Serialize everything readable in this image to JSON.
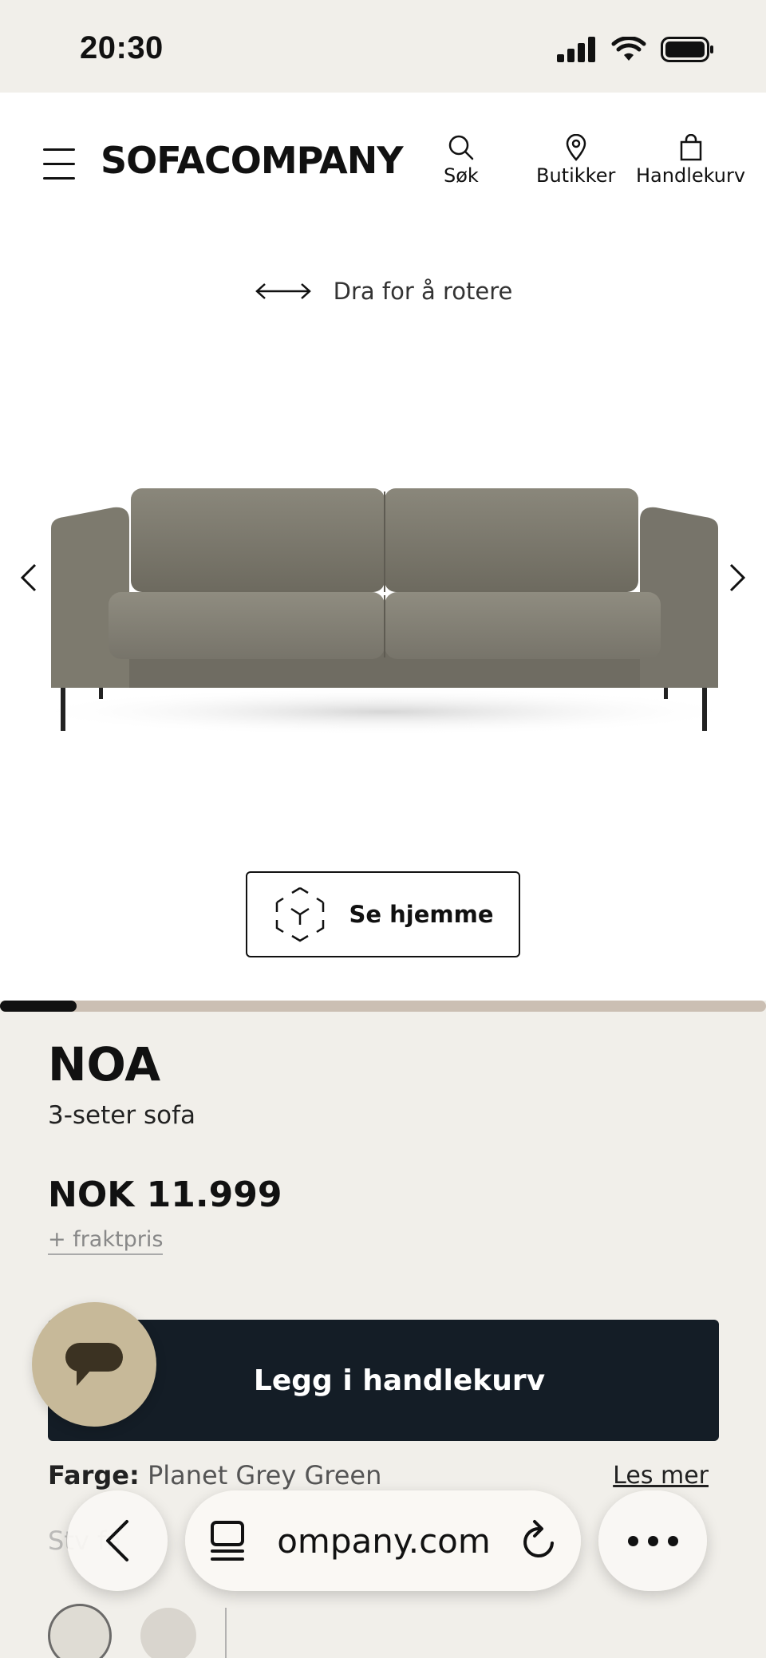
{
  "status_bar": {
    "time": "20:30"
  },
  "header": {
    "logo": "SOFACOMPANY",
    "search_label": "Søk",
    "stores_label": "Butikker",
    "cart_label": "Handlekurv"
  },
  "viewer": {
    "rotate_hint": "Dra for å rotere",
    "see_home_label": "Se hjemme",
    "carousel_progress": 0.1
  },
  "product": {
    "name": "NOA",
    "subtitle": "3-seter sofa",
    "price": "NOK 11.999",
    "freight": "+ fraktpris",
    "add_to_cart": "Legg i handlekurv",
    "color_label": "Farge:",
    "color_value": "Planet Grey Green",
    "read_more": "Les mer",
    "faded_row": "Stv    fa"
  },
  "browser": {
    "url": "ompany.com"
  },
  "colors": {
    "page_bg": "#f1efea",
    "cart_button": "#141d26",
    "chat_button": "#c7b999",
    "sofa": "#7d7a6e",
    "progress_track": "#cbbfb3"
  },
  "icons": [
    "menu-icon",
    "search-icon",
    "location-pin-icon",
    "shopping-bag-icon",
    "rotate-arrows-icon",
    "chevron-left-icon",
    "chevron-right-icon",
    "ar-cube-icon",
    "chat-icon",
    "back-icon",
    "tabs-icon",
    "reload-icon",
    "more-icon"
  ]
}
